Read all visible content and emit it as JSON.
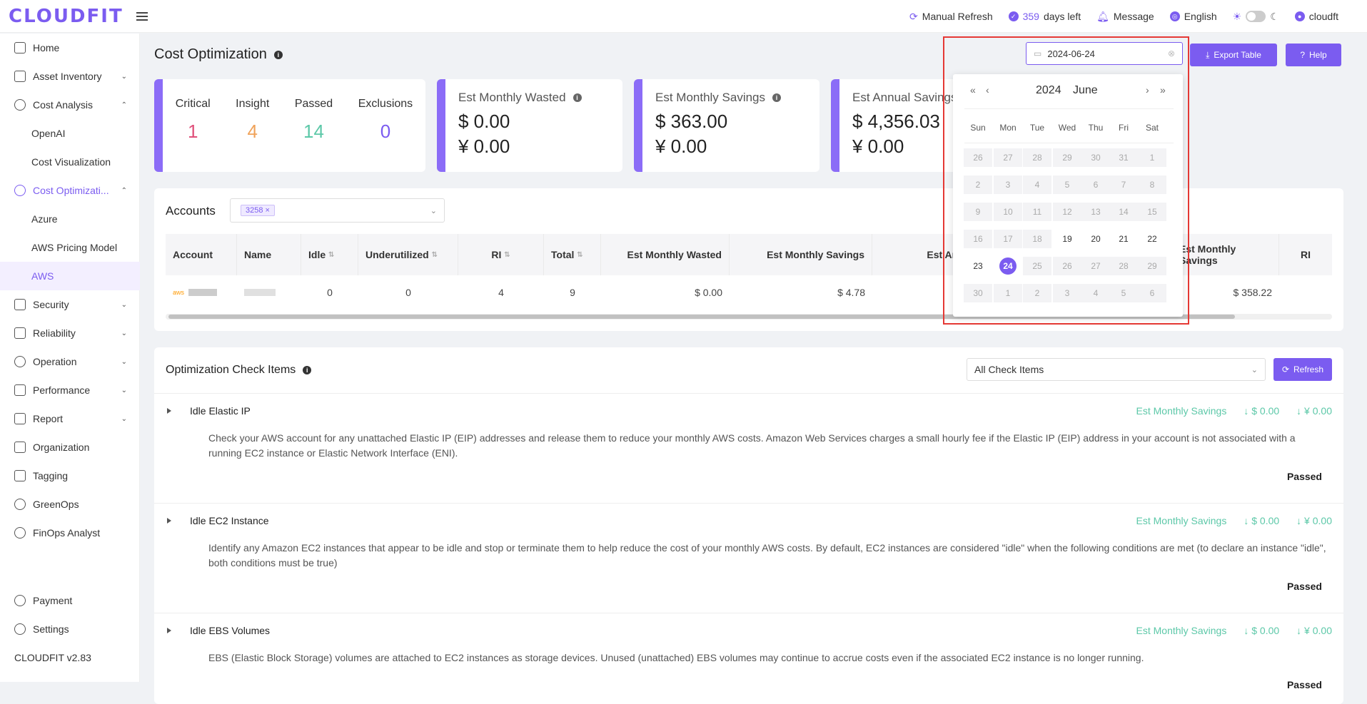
{
  "app": {
    "logo": "CLOUDFIT",
    "version": "CLOUDFIT v2.83"
  },
  "topbar": {
    "refresh": "Manual Refresh",
    "days_num": "359",
    "days_text": "days left",
    "message": "Message",
    "language": "English",
    "user": "cloudft"
  },
  "sidebar": {
    "items": [
      {
        "label": "Home"
      },
      {
        "label": "Asset Inventory"
      },
      {
        "label": "Cost Analysis"
      },
      {
        "label": "OpenAI"
      },
      {
        "label": "Cost Visualization"
      },
      {
        "label": "Cost Optimizati..."
      },
      {
        "label": "Azure"
      },
      {
        "label": "AWS Pricing Model"
      },
      {
        "label": "AWS"
      },
      {
        "label": "Security"
      },
      {
        "label": "Reliability"
      },
      {
        "label": "Operation"
      },
      {
        "label": "Performance"
      },
      {
        "label": "Report"
      },
      {
        "label": "Organization"
      },
      {
        "label": "Tagging"
      },
      {
        "label": "GreenOps"
      },
      {
        "label": "FinOps Analyst"
      },
      {
        "label": "Payment"
      },
      {
        "label": "Settings"
      }
    ]
  },
  "page": {
    "title": "Cost Optimization",
    "export": "Export Table",
    "help": "Help"
  },
  "cards": {
    "severity": {
      "critical_label": "Critical",
      "critical": "1",
      "insight_label": "Insight",
      "insight": "4",
      "passed_label": "Passed",
      "passed": "14",
      "exclusions_label": "Exclusions",
      "exclusions": "0"
    },
    "wasted": {
      "title": "Est Monthly Wasted",
      "usd": "$ 0.00",
      "cny": "¥ 0.00"
    },
    "savings": {
      "title": "Est Monthly Savings",
      "usd": "$ 363.00",
      "cny": "¥ 0.00"
    },
    "annual": {
      "title": "Est Annual Savings",
      "usd": "$ 4,356.03",
      "cny": "¥ 0.00"
    }
  },
  "accounts": {
    "label": "Accounts",
    "tag": "3258",
    "tag_close": "×",
    "headers": [
      "Account",
      "Name",
      "Idle",
      "Underutilized",
      "RI",
      "Total",
      "Est Monthly Wasted",
      "Est Monthly Savings",
      "Est Annual",
      "Est Monthly Savings",
      "RI"
    ],
    "row": {
      "idle": "0",
      "under": "0",
      "ri": "4",
      "total": "9",
      "wasted": "$ 0.00",
      "savings": "$ 4.78",
      "savings2": "$ 358.22",
      "aws": "aws"
    }
  },
  "checks": {
    "title": "Optimization Check Items",
    "select": "All Check Items",
    "refresh": "Refresh",
    "sav_label": "Est Monthly Savings",
    "items": [
      {
        "title": "Idle Elastic IP",
        "usd": "↓ $ 0.00",
        "cny": "↓ ¥ 0.00",
        "desc": "Check your AWS account for any unattached Elastic IP (EIP) addresses and release them to reduce your monthly AWS costs. Amazon Web Services charges a small hourly fee if the Elastic IP (EIP) address in your account is not associated with a running EC2 instance or Elastic Network Interface (ENI).",
        "status": "Passed"
      },
      {
        "title": "Idle EC2 Instance",
        "usd": "↓ $ 0.00",
        "cny": "↓ ¥ 0.00",
        "desc": "Identify any Amazon EC2 instances that appear to be idle and stop or terminate them to help reduce the cost of your monthly AWS costs. By default, EC2 instances are considered \"idle\" when the following conditions are met (to declare an instance \"idle\", both conditions must be true)",
        "status": "Passed"
      },
      {
        "title": "Idle EBS Volumes",
        "usd": "↓ $ 0.00",
        "cny": "↓ ¥ 0.00",
        "desc": "EBS (Elastic Block Storage) volumes are attached to EC2 instances as storage devices. Unused (unattached) EBS volumes may continue to accrue costs even if the associated EC2 instance is no longer running.",
        "status": "Passed"
      }
    ]
  },
  "datepicker": {
    "value": "2024-06-24",
    "year": "2024",
    "month": "June",
    "weekdays": [
      "Sun",
      "Mon",
      "Tue",
      "Wed",
      "Thu",
      "Fri",
      "Sat"
    ],
    "weeks": [
      [
        "26",
        "27",
        "28",
        "29",
        "30",
        "31",
        "1"
      ],
      [
        "2",
        "3",
        "4",
        "5",
        "6",
        "7",
        "8"
      ],
      [
        "9",
        "10",
        "11",
        "12",
        "13",
        "14",
        "15"
      ],
      [
        "16",
        "17",
        "18",
        "19",
        "20",
        "21",
        "22"
      ],
      [
        "23",
        "24",
        "25",
        "26",
        "27",
        "28",
        "29"
      ],
      [
        "30",
        "1",
        "2",
        "3",
        "4",
        "5",
        "6"
      ]
    ],
    "selected": "24"
  },
  "colors": {
    "accent": "#7b5cf0",
    "critical": "#e0507a",
    "insight": "#f0a35a",
    "passed": "#5cc8a8",
    "highlight": "#e53935"
  }
}
